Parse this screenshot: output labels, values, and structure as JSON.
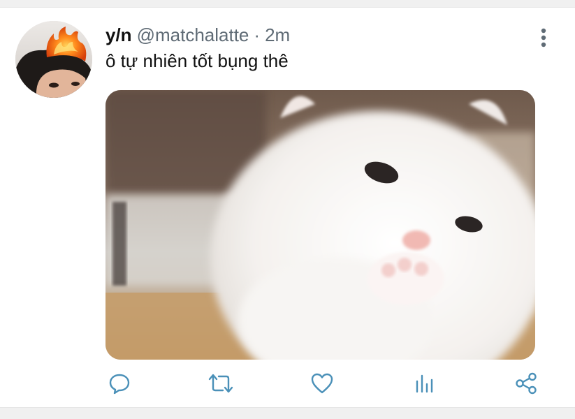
{
  "tweet": {
    "author": {
      "display_name": "y/n",
      "handle": "@matchalatte"
    },
    "separator": "·",
    "time": "2m",
    "text": "ô tự nhiên tốt bụng thê",
    "media": {
      "description_icon": "kitten-photo"
    },
    "actions": [
      {
        "icon": "reply-icon"
      },
      {
        "icon": "retweet-icon"
      },
      {
        "icon": "like-icon"
      },
      {
        "icon": "analytics-icon"
      },
      {
        "icon": "share-icon"
      }
    ],
    "menu_icon": "more-vertical-icon"
  },
  "colors": {
    "text_primary": "#111111",
    "text_secondary": "#5f6b75",
    "icon": "#4a90b8",
    "divider": "#f0f0f0"
  }
}
